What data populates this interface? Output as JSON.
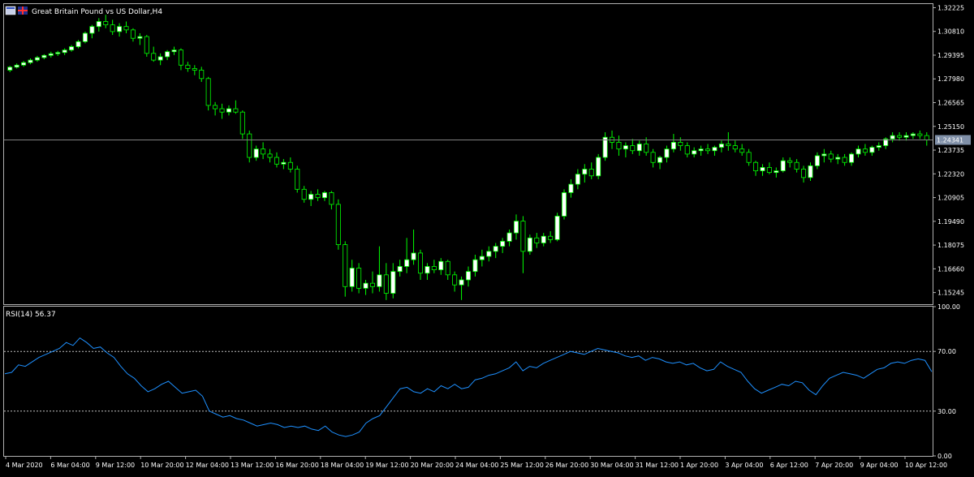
{
  "chart_data": [
    {
      "type": "candlestick",
      "title": "Great Britain Pound vs US Dollar,H4",
      "ylim": [
        1.1455,
        1.3244
      ],
      "yticks": [
        "1.32225",
        "1.30810",
        "1.29395",
        "1.27980",
        "1.26565",
        "1.25150",
        "1.23735",
        "1.22320",
        "1.20905",
        "1.19490",
        "1.18075",
        "1.16660",
        "1.15245"
      ],
      "current_price": "1.24341",
      "colors": {
        "up_candle": "#ffffff",
        "down_candle": "#000000",
        "wick": "#00ff00",
        "price_line": "#808080"
      },
      "candles": [
        [
          1.285,
          1.2876,
          1.2838,
          1.2868
        ],
        [
          1.2868,
          1.289,
          1.286,
          1.288
        ],
        [
          1.288,
          1.2905,
          1.287,
          1.2895
        ],
        [
          1.2895,
          1.292,
          1.2885,
          1.291
        ],
        [
          1.291,
          1.2935,
          1.29,
          1.2925
        ],
        [
          1.2925,
          1.2945,
          1.2915,
          1.2938
        ],
        [
          1.2938,
          1.296,
          1.2925,
          1.2948
        ],
        [
          1.2948,
          1.2965,
          1.2935,
          1.2955
        ],
        [
          1.2955,
          1.298,
          1.294,
          1.297
        ],
        [
          1.297,
          1.3,
          1.296,
          1.299
        ],
        [
          1.299,
          1.303,
          1.298,
          1.302
        ],
        [
          1.302,
          1.308,
          1.301,
          1.307
        ],
        [
          1.307,
          1.312,
          1.304,
          1.311
        ],
        [
          1.311,
          1.316,
          1.308,
          1.314
        ],
        [
          1.314,
          1.318,
          1.31,
          1.312
        ],
        [
          1.312,
          1.315,
          1.306,
          1.308
        ],
        [
          1.308,
          1.313,
          1.305,
          1.311
        ],
        [
          1.311,
          1.314,
          1.307,
          1.309
        ],
        [
          1.309,
          1.31,
          1.302,
          1.304
        ],
        [
          1.304,
          1.307,
          1.3,
          1.305
        ],
        [
          1.305,
          1.306,
          1.293,
          1.295
        ],
        [
          1.295,
          1.299,
          1.29,
          1.291
        ],
        [
          1.291,
          1.295,
          1.288,
          1.293
        ],
        [
          1.293,
          1.297,
          1.291,
          1.296
        ],
        [
          1.296,
          1.299,
          1.294,
          1.297
        ],
        [
          1.297,
          1.298,
          1.285,
          1.288
        ],
        [
          1.288,
          1.29,
          1.284,
          1.286
        ],
        [
          1.286,
          1.288,
          1.282,
          1.285
        ],
        [
          1.285,
          1.287,
          1.278,
          1.28
        ],
        [
          1.28,
          1.281,
          1.261,
          1.264
        ],
        [
          1.264,
          1.266,
          1.258,
          1.262
        ],
        [
          1.262,
          1.265,
          1.256,
          1.26
        ],
        [
          1.26,
          1.264,
          1.258,
          1.262
        ],
        [
          1.262,
          1.267,
          1.259,
          1.26
        ],
        [
          1.26,
          1.261,
          1.244,
          1.247
        ],
        [
          1.247,
          1.249,
          1.23,
          1.233
        ],
        [
          1.233,
          1.24,
          1.231,
          1.238
        ],
        [
          1.238,
          1.242,
          1.232,
          1.235
        ],
        [
          1.235,
          1.238,
          1.23,
          1.233
        ],
        [
          1.233,
          1.236,
          1.227,
          1.229
        ],
        [
          1.229,
          1.232,
          1.226,
          1.23
        ],
        [
          1.23,
          1.233,
          1.224,
          1.226
        ],
        [
          1.226,
          1.228,
          1.212,
          1.214
        ],
        [
          1.214,
          1.216,
          1.206,
          1.208
        ],
        [
          1.208,
          1.213,
          1.204,
          1.211
        ],
        [
          1.211,
          1.214,
          1.207,
          1.209
        ],
        [
          1.209,
          1.213,
          1.207,
          1.212
        ],
        [
          1.212,
          1.213,
          1.202,
          1.205
        ],
        [
          1.205,
          1.208,
          1.178,
          1.181
        ],
        [
          1.181,
          1.183,
          1.15,
          1.156
        ],
        [
          1.156,
          1.172,
          1.153,
          1.167
        ],
        [
          1.167,
          1.17,
          1.152,
          1.155
        ],
        [
          1.155,
          1.16,
          1.151,
          1.158
        ],
        [
          1.158,
          1.165,
          1.152,
          1.156
        ],
        [
          1.156,
          1.18,
          1.153,
          1.163
        ],
        [
          1.163,
          1.17,
          1.148,
          1.152
        ],
        [
          1.152,
          1.17,
          1.149,
          1.165
        ],
        [
          1.165,
          1.172,
          1.162,
          1.168
        ],
        [
          1.168,
          1.185,
          1.164,
          1.172
        ],
        [
          1.172,
          1.19,
          1.169,
          1.176
        ],
        [
          1.176,
          1.178,
          1.16,
          1.164
        ],
        [
          1.164,
          1.17,
          1.16,
          1.168
        ],
        [
          1.168,
          1.172,
          1.164,
          1.166
        ],
        [
          1.166,
          1.173,
          1.163,
          1.171
        ],
        [
          1.171,
          1.172,
          1.16,
          1.163
        ],
        [
          1.163,
          1.165,
          1.153,
          1.157
        ],
        [
          1.157,
          1.162,
          1.148,
          1.16
        ],
        [
          1.16,
          1.168,
          1.156,
          1.165
        ],
        [
          1.165,
          1.175,
          1.162,
          1.172
        ],
        [
          1.172,
          1.178,
          1.168,
          1.174
        ],
        [
          1.174,
          1.18,
          1.171,
          1.177
        ],
        [
          1.177,
          1.182,
          1.173,
          1.18
        ],
        [
          1.18,
          1.185,
          1.176,
          1.183
        ],
        [
          1.183,
          1.19,
          1.18,
          1.188
        ],
        [
          1.188,
          1.199,
          1.184,
          1.195
        ],
        [
          1.195,
          1.198,
          1.164,
          1.177
        ],
        [
          1.177,
          1.187,
          1.175,
          1.185
        ],
        [
          1.185,
          1.188,
          1.179,
          1.182
        ],
        [
          1.182,
          1.188,
          1.18,
          1.186
        ],
        [
          1.186,
          1.189,
          1.182,
          1.184
        ],
        [
          1.184,
          1.2,
          1.183,
          1.198
        ],
        [
          1.198,
          1.214,
          1.196,
          1.212
        ],
        [
          1.212,
          1.22,
          1.209,
          1.217
        ],
        [
          1.217,
          1.226,
          1.214,
          1.223
        ],
        [
          1.223,
          1.229,
          1.218,
          1.226
        ],
        [
          1.226,
          1.23,
          1.22,
          1.222
        ],
        [
          1.222,
          1.235,
          1.22,
          1.233
        ],
        [
          1.233,
          1.248,
          1.231,
          1.245
        ],
        [
          1.245,
          1.249,
          1.238,
          1.242
        ],
        [
          1.242,
          1.246,
          1.234,
          1.238
        ],
        [
          1.238,
          1.242,
          1.233,
          1.24
        ],
        [
          1.24,
          1.244,
          1.235,
          1.237
        ],
        [
          1.237,
          1.243,
          1.234,
          1.241
        ],
        [
          1.241,
          1.245,
          1.234,
          1.236
        ],
        [
          1.236,
          1.238,
          1.227,
          1.23
        ],
        [
          1.23,
          1.234,
          1.226,
          1.233
        ],
        [
          1.233,
          1.24,
          1.23,
          1.238
        ],
        [
          1.238,
          1.247,
          1.236,
          1.242
        ],
        [
          1.242,
          1.245,
          1.237,
          1.24
        ],
        [
          1.24,
          1.242,
          1.233,
          1.235
        ],
        [
          1.235,
          1.239,
          1.233,
          1.237
        ],
        [
          1.237,
          1.24,
          1.234,
          1.238
        ],
        [
          1.238,
          1.241,
          1.235,
          1.237
        ],
        [
          1.237,
          1.24,
          1.234,
          1.239
        ],
        [
          1.239,
          1.243,
          1.236,
          1.241
        ],
        [
          1.241,
          1.248,
          1.237,
          1.24
        ],
        [
          1.24,
          1.243,
          1.236,
          1.238
        ],
        [
          1.238,
          1.241,
          1.234,
          1.236
        ],
        [
          1.236,
          1.238,
          1.228,
          1.23
        ],
        [
          1.23,
          1.231,
          1.222,
          1.225
        ],
        [
          1.225,
          1.229,
          1.222,
          1.227
        ],
        [
          1.227,
          1.23,
          1.223,
          1.224
        ],
        [
          1.224,
          1.227,
          1.221,
          1.225
        ],
        [
          1.225,
          1.233,
          1.224,
          1.231
        ],
        [
          1.231,
          1.233,
          1.227,
          1.23
        ],
        [
          1.23,
          1.232,
          1.224,
          1.226
        ],
        [
          1.226,
          1.228,
          1.218,
          1.221
        ],
        [
          1.221,
          1.23,
          1.219,
          1.228
        ],
        [
          1.228,
          1.236,
          1.226,
          1.234
        ],
        [
          1.234,
          1.238,
          1.23,
          1.235
        ],
        [
          1.235,
          1.237,
          1.23,
          1.232
        ],
        [
          1.232,
          1.235,
          1.229,
          1.233
        ],
        [
          1.233,
          1.235,
          1.228,
          1.23
        ],
        [
          1.23,
          1.236,
          1.228,
          1.235
        ],
        [
          1.235,
          1.24,
          1.233,
          1.238
        ],
        [
          1.238,
          1.241,
          1.234,
          1.236
        ],
        [
          1.236,
          1.24,
          1.234,
          1.239
        ],
        [
          1.239,
          1.242,
          1.237,
          1.24
        ],
        [
          1.24,
          1.245,
          1.238,
          1.244
        ],
        [
          1.244,
          1.248,
          1.242,
          1.246
        ],
        [
          1.246,
          1.248,
          1.243,
          1.245
        ],
        [
          1.245,
          1.248,
          1.243,
          1.246
        ],
        [
          1.246,
          1.248,
          1.244,
          1.247
        ],
        [
          1.247,
          1.249,
          1.244,
          1.246
        ],
        [
          1.246,
          1.248,
          1.24,
          1.2434
        ]
      ]
    },
    {
      "type": "line",
      "title": "RSI(14) 56.37",
      "ylim": [
        0,
        100
      ],
      "yticks": [
        "100.00",
        "70.00",
        "30.00",
        "0.00"
      ],
      "levels": [
        70,
        30
      ],
      "series_color": "#1e90ff",
      "values": [
        55,
        56,
        61,
        60,
        63,
        66,
        68,
        70,
        72,
        76,
        74,
        79,
        76,
        72,
        73,
        69,
        66,
        60,
        55,
        52,
        47,
        43,
        45,
        48,
        50,
        46,
        42,
        43,
        44,
        40,
        30,
        28,
        26,
        27,
        25,
        24,
        22,
        20,
        21,
        22,
        21,
        19,
        20,
        19,
        20,
        18,
        17,
        20,
        16,
        14,
        13,
        14,
        16,
        22,
        25,
        27,
        33,
        39,
        45,
        46,
        43,
        42,
        45,
        43,
        47,
        45,
        48,
        45,
        46,
        51,
        52,
        54,
        55,
        57,
        59,
        63,
        57,
        60,
        59,
        62,
        64,
        66,
        68,
        70,
        69,
        68,
        70,
        72,
        71,
        70,
        69,
        67,
        66,
        67,
        64,
        66,
        65,
        63,
        62,
        63,
        61,
        62,
        59,
        57,
        58,
        63,
        60,
        58,
        56,
        50,
        45,
        42,
        44,
        46,
        48,
        47,
        50,
        49,
        44,
        41,
        47,
        52,
        54,
        56,
        55,
        54,
        52,
        55,
        58,
        59,
        62,
        63,
        62,
        64,
        65,
        64,
        56.37
      ],
      "xticks": [
        "4 Mar 2020",
        "6 Mar 04:00",
        "9 Mar 12:00",
        "10 Mar 20:00",
        "12 Mar 04:00",
        "13 Mar 12:00",
        "16 Mar 20:00",
        "18 Mar 04:00",
        "19 Mar 12:00",
        "20 Mar 20:00",
        "24 Mar 04:00",
        "25 Mar 12:00",
        "26 Mar 20:00",
        "30 Mar 04:00",
        "31 Mar 12:00",
        "1 Apr 20:00",
        "3 Apr 04:00",
        "6 Apr 12:00",
        "7 Apr 20:00",
        "9 Apr 04:00",
        "10 Apr 12:00"
      ]
    }
  ]
}
